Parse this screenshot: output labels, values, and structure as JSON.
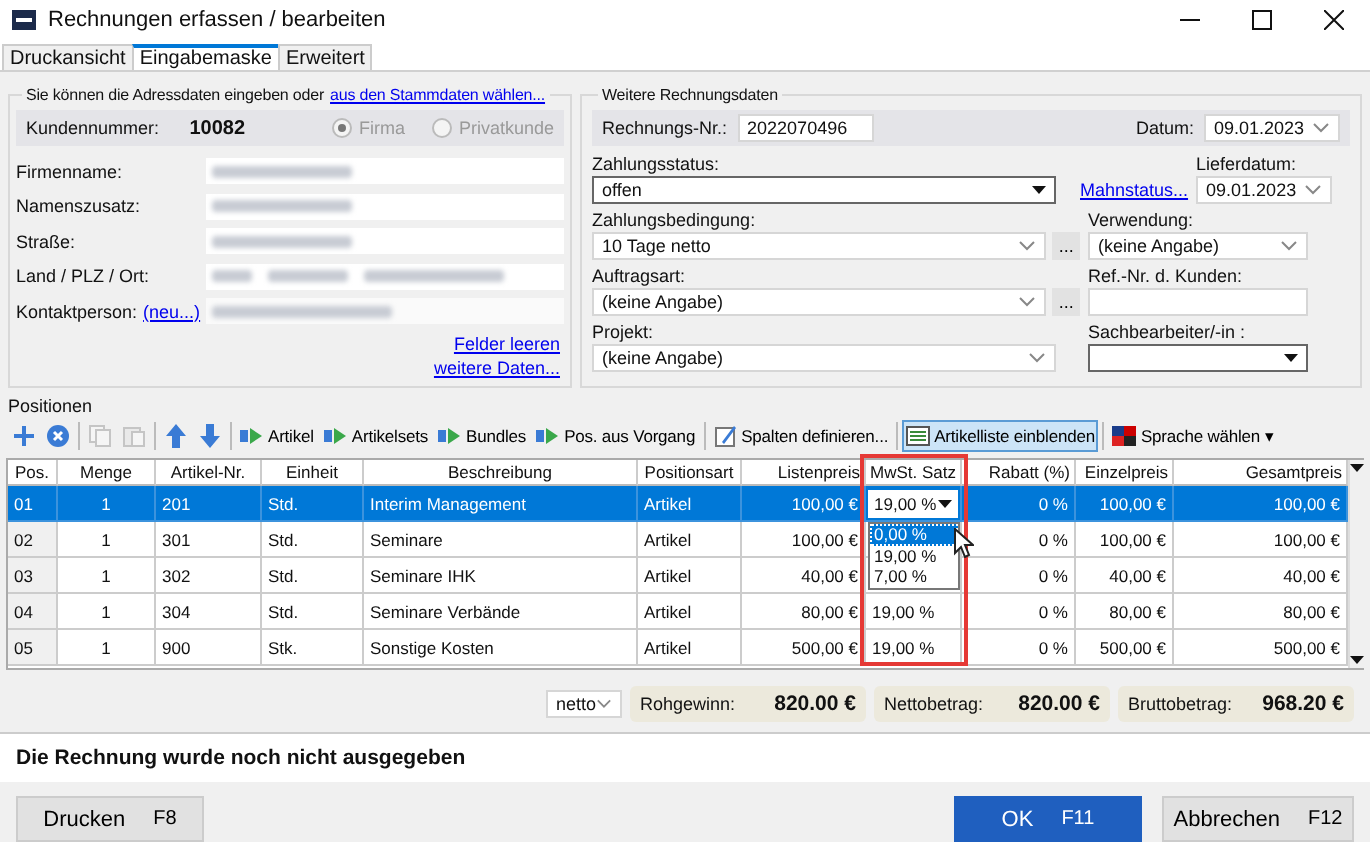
{
  "window": {
    "title": "Rechnungen erfassen / bearbeiten"
  },
  "tabs": [
    {
      "label": "Druckansicht",
      "selected": false
    },
    {
      "label": "Eingabemaske",
      "selected": true
    },
    {
      "label": "Erweitert",
      "selected": false
    }
  ],
  "address": {
    "intro": "Sie können die Adressdaten eingeben oder",
    "intro_link": "aus den Stammdaten wählen...",
    "customer_label": "Kundennummer:",
    "customer_number": "10082",
    "radios": [
      {
        "label": "Firma",
        "selected": true,
        "disabled": true
      },
      {
        "label": "Privatkunde",
        "selected": false,
        "disabled": true
      }
    ],
    "fields": [
      {
        "label": "Firmenname:",
        "kind": "blurred"
      },
      {
        "label": "Namenszusatz:",
        "kind": "blurred"
      },
      {
        "label": "Straße:",
        "kind": "blurred"
      },
      {
        "label": "Land / PLZ / Ort:",
        "kind": "blurred3"
      },
      {
        "label": "Kontaktperson:",
        "link": "(neu...)",
        "kind": "blurred-combo"
      }
    ],
    "links": [
      "Felder leeren",
      "weitere Daten..."
    ]
  },
  "invoice": {
    "title": "Weitere Rechnungsdaten",
    "number_label": "Rechnungs-Nr.:",
    "number": "2022070496",
    "date_label": "Datum:",
    "date": "09.01.2023",
    "rows": [
      {
        "left": {
          "label": "Zahlungsstatus:",
          "value": "offen",
          "kind": "dropdown"
        },
        "link": "Mahnstatus...",
        "right": {
          "label": "Lieferdatum:",
          "value": "09.01.2023",
          "kind": "date"
        }
      },
      {
        "left": {
          "label": "Zahlungsbedingung:",
          "value": "10 Tage netto",
          "kind": "combo",
          "more": "..."
        },
        "right": {
          "label": "Verwendung:",
          "value": "(keine Angabe)",
          "kind": "combo"
        }
      },
      {
        "left": {
          "label": "Auftragsart:",
          "value": "(keine Angabe)",
          "kind": "combo",
          "more": "..."
        },
        "right": {
          "label": "Ref.-Nr. d. Kunden:",
          "kind": "text"
        }
      },
      {
        "left": {
          "label": "Projekt:",
          "value": "(keine Angabe)",
          "kind": "combo"
        },
        "right": {
          "label": "Sachbearbeiter/-in :",
          "kind": "dropdown"
        }
      }
    ]
  },
  "positions": {
    "title": "Positionen",
    "toolbar": [
      {
        "kind": "add"
      },
      {
        "kind": "cancel"
      },
      {
        "kind": "sep"
      },
      {
        "kind": "copy",
        "disabled": true
      },
      {
        "kind": "paste",
        "disabled": true
      },
      {
        "kind": "sep"
      },
      {
        "kind": "up"
      },
      {
        "kind": "down"
      },
      {
        "kind": "sep"
      },
      {
        "kind": "insert",
        "label": "Artikel"
      },
      {
        "kind": "insert",
        "label": "Artikelsets"
      },
      {
        "kind": "insert",
        "label": "Bundles"
      },
      {
        "kind": "insert",
        "label": "Pos. aus Vorgang"
      },
      {
        "kind": "sep"
      },
      {
        "kind": "columns",
        "label": "Spalten definieren..."
      },
      {
        "kind": "sep"
      },
      {
        "kind": "list",
        "label": "Artikelliste einblenden",
        "selected": true
      },
      {
        "kind": "sep"
      },
      {
        "kind": "flag",
        "label": "Sprache wählen",
        "menu": "▾"
      }
    ],
    "columns": [
      "Pos.",
      "Menge",
      "Artikel-Nr.",
      "Einheit",
      "Beschreibung",
      "Positionsart",
      "Listenpreis",
      "MwSt. Satz",
      "Rabatt (%)",
      "Einzelpreis",
      "Gesamtpreis"
    ],
    "rows": [
      {
        "selected": true,
        "cells": [
          "01",
          "1",
          "201",
          "Std.",
          "Interim Management",
          "Artikel",
          "100,00 €",
          "19,00 %",
          "0 %",
          "100,00 €",
          "100,00 €"
        ]
      },
      {
        "selected": false,
        "cells": [
          "02",
          "1",
          "301",
          "Std.",
          "Seminare",
          "Artikel",
          "100,00 €",
          null,
          "0 %",
          "100,00 €",
          "100,00 €"
        ]
      },
      {
        "selected": false,
        "cells": [
          "03",
          "1",
          "302",
          "Std.",
          "Seminare IHK",
          "Artikel",
          "40,00 €",
          null,
          "0 %",
          "40,00 €",
          "40,00 €"
        ]
      },
      {
        "selected": false,
        "cells": [
          "04",
          "1",
          "304",
          "Std.",
          "Seminare Verbände",
          "Artikel",
          "80,00 €",
          "19,00 %",
          "0 %",
          "80,00 €",
          "80,00 €"
        ]
      },
      {
        "selected": false,
        "cells": [
          "05",
          "1",
          "900",
          "Stk.",
          "Sonstige Kosten",
          "Artikel",
          "500,00 €",
          "19,00 %",
          "0 %",
          "500,00 €",
          "500,00 €"
        ]
      }
    ],
    "vat_options": [
      {
        "label": "0,00 %",
        "selected": true
      },
      {
        "label": "19,00 %",
        "selected": false
      },
      {
        "label": "7,00 %",
        "selected": false
      }
    ]
  },
  "totals": {
    "mode": "netto",
    "items": [
      {
        "label": "Rohgewinn:",
        "value": "820.00 €"
      },
      {
        "label": "Nettobetrag:",
        "value": "820.00 €"
      },
      {
        "label": "Bruttobetrag:",
        "value": "968.20 €"
      }
    ]
  },
  "status": "Die Rechnung wurde noch nicht ausgegeben",
  "buttons": [
    {
      "label": "Drucken",
      "key": "F8",
      "primary": false
    },
    {
      "label": "OK",
      "key": "F11",
      "primary": true
    },
    {
      "label": "Abbrechen",
      "key": "F12",
      "primary": false
    }
  ]
}
